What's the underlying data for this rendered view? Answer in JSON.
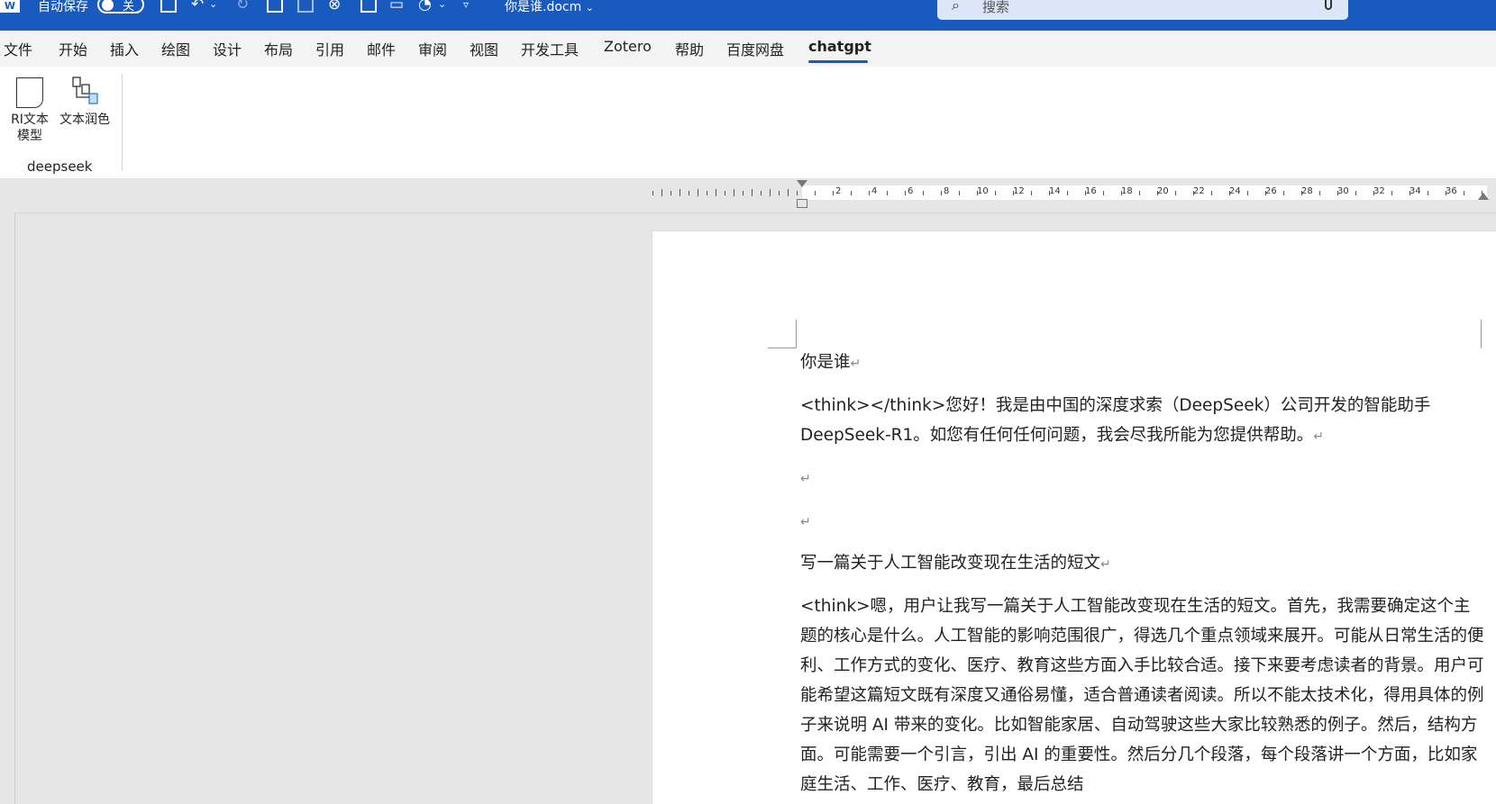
{
  "titlebar": {
    "app_icon": "W",
    "autosave_label": "自动保存",
    "autosave_state": "关",
    "doc_title": "你是谁.docm",
    "search_placeholder": "搜索",
    "icons": [
      "word-icon",
      "save-icon",
      "undo-icon",
      "redo-icon",
      "new-doc-icon",
      "template-icon",
      "close-circle-icon",
      "document-icon",
      "comment-icon",
      "shapes-icon",
      "customize-icon",
      "chevron-down-icon",
      "search-icon",
      "microphone-icon"
    ]
  },
  "tabs": [
    {
      "label": "文件"
    },
    {
      "label": "开始"
    },
    {
      "label": "插入"
    },
    {
      "label": "绘图"
    },
    {
      "label": "设计"
    },
    {
      "label": "布局"
    },
    {
      "label": "引用"
    },
    {
      "label": "邮件"
    },
    {
      "label": "审阅"
    },
    {
      "label": "视图"
    },
    {
      "label": "开发工具"
    },
    {
      "label": "Zotero"
    },
    {
      "label": "帮助"
    },
    {
      "label": "百度网盘"
    },
    {
      "label": "chatgpt",
      "active": true
    }
  ],
  "ribbon": {
    "buttons": [
      {
        "label_line1": "RI文本",
        "label_line2": "模型",
        "icon": "document-icon"
      },
      {
        "label_line1": "文本润色",
        "label_line2": "",
        "icon": "flowchart-icon"
      }
    ],
    "group_label": "deepseek"
  },
  "ruler": {
    "numbers": [
      "2",
      "4",
      "6",
      "8",
      "10",
      "12",
      "14",
      "16",
      "18",
      "20",
      "22",
      "24",
      "26",
      "28",
      "30",
      "32",
      "34",
      "36"
    ]
  },
  "document": {
    "paragraphs": [
      "你是谁",
      "<think></think>您好！我是由中国的深度求索（DeepSeek）公司开发的智能助手 DeepSeek-R1。如您有任何任何问题，我会尽我所能为您提供帮助。",
      "",
      "",
      "写一篇关于人工智能改变现在生活的短文",
      "<think>嗯，用户让我写一篇关于人工智能改变现在生活的短文。首先，我需要确定这个主题的核心是什么。人工智能的影响范围很广，得选几个重点领域来展开。可能从日常生活的便利、工作方式的变化、医疗、教育这些方面入手比较合适。接下来要考虑读者的背景。用户可能希望这篇短文既有深度又通俗易懂，适合普通读者阅读。所以不能太技术化，得用具体的例子来说明 AI 带来的变化。比如智能家居、自动驾驶这些大家比较熟悉的例子。然后，结构方面。可能需要一个引言，引出 AI 的重要性。然后分几个段落，每个段落讲一个方面，比如家庭生活、工作、医疗、教育，最后总结"
    ],
    "paragraph_mark": "↵"
  },
  "colors": {
    "titlebar": "#185abd",
    "tab_active_underline": "#185abd",
    "workspace": "#e6e6e6",
    "page": "#ffffff"
  }
}
